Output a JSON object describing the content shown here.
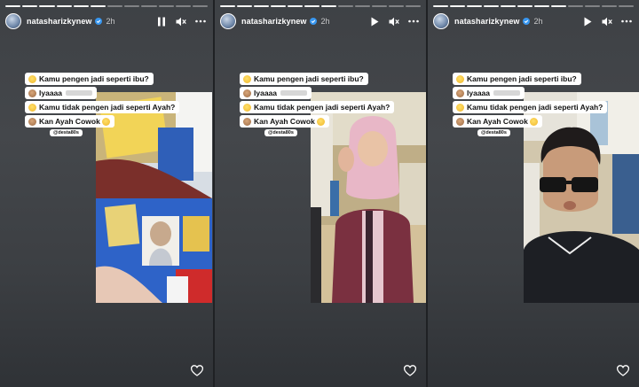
{
  "story": {
    "username": "natasharizkynew",
    "time": "2h",
    "handle": "@desta80s",
    "captions": [
      {
        "emoji": "yellow",
        "text": "Kamu pengen jadi seperti ibu?"
      },
      {
        "emoji": "monkey",
        "text": "Iyaaaa",
        "blur": true
      },
      {
        "emoji": "yellow",
        "text": "Kamu tidak pengen jadi seperti Ayah?"
      },
      {
        "emoji": "monkey",
        "text": "Kan Ayah Cowok",
        "grin": true
      }
    ]
  },
  "panels": [
    {
      "play_state": "pause",
      "progress_done": 6,
      "progress_total": 12
    },
    {
      "play_state": "play",
      "progress_done": 7,
      "progress_total": 12
    },
    {
      "play_state": "play",
      "progress_done": 8,
      "progress_total": 12
    }
  ],
  "icons": {
    "avatar": "avatar-image",
    "verified": "verified-badge-icon",
    "pause": "pause-icon",
    "play": "play-icon",
    "mute": "muted-speaker-icon",
    "more": "more-options-icon",
    "like": "heart-icon"
  },
  "colors": {
    "background": "#3e4145",
    "caption_bg": "#ffffff",
    "verified": "#3897f0"
  }
}
